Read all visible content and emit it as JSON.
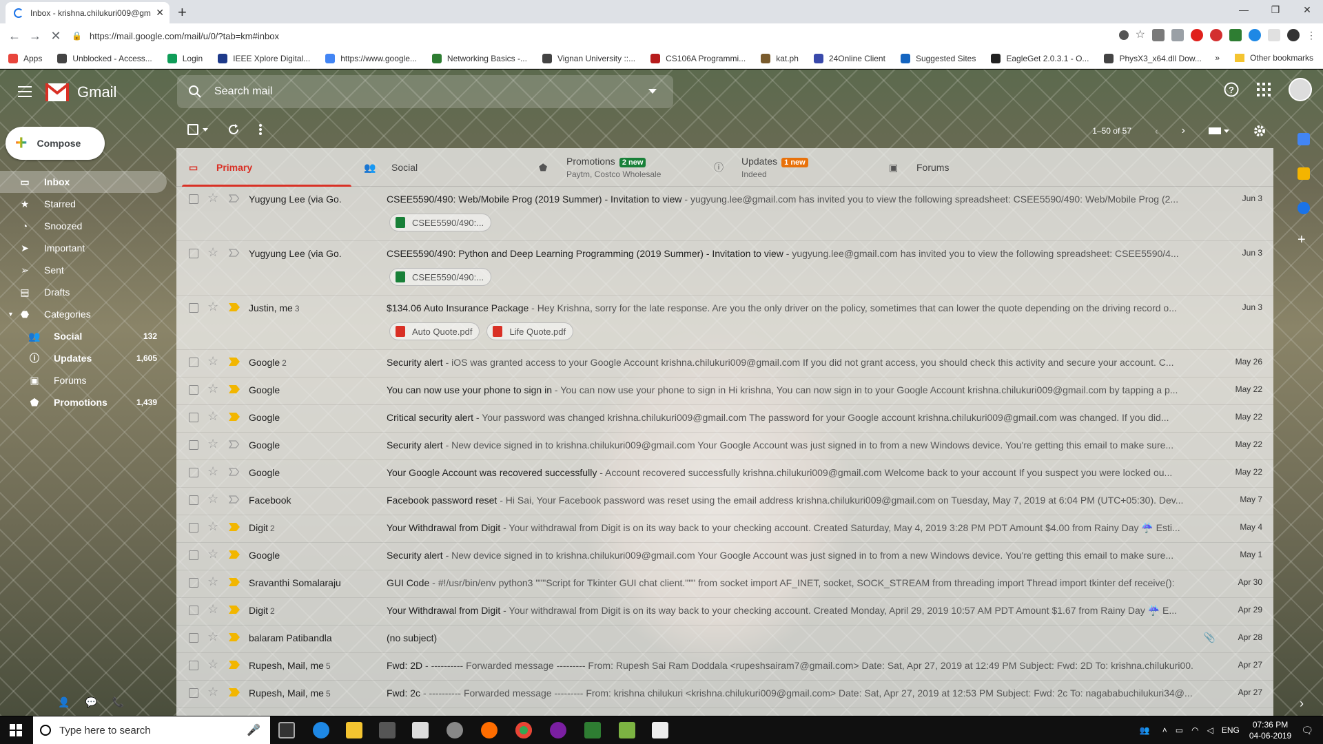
{
  "browser": {
    "tab_title": "Inbox - krishna.chilukuri009@gm",
    "url": "https://mail.google.com/mail/u/0/?tab=km#inbox",
    "bookmarks": [
      {
        "label": "Apps",
        "color": "#e8453c"
      },
      {
        "label": "Unblocked - Access...",
        "color": "#444"
      },
      {
        "label": "Login",
        "color": "#0f9d58"
      },
      {
        "label": "IEEE Xplore Digital...",
        "color": "#1e3a8a"
      },
      {
        "label": "https://www.google...",
        "color": "#4285f4"
      },
      {
        "label": "Networking Basics -...",
        "color": "#2e7d32"
      },
      {
        "label": "Vignan University ::...",
        "color": "#444"
      },
      {
        "label": "CS106A Programmi...",
        "color": "#b71c1c"
      },
      {
        "label": "kat.ph",
        "color": "#7a5c2e"
      },
      {
        "label": "24Online Client",
        "color": "#3949ab"
      },
      {
        "label": "Suggested Sites",
        "color": "#1565c0"
      },
      {
        "label": "EagleGet 2.0.3.1 - O...",
        "color": "#222"
      },
      {
        "label": "PhysX3_x64.dll Dow...",
        "color": "#444"
      }
    ],
    "bookmarks_more": "»",
    "other_bookmarks": "Other bookmarks"
  },
  "gmail": {
    "logo_text": "Gmail",
    "search_placeholder": "Search mail",
    "compose_label": "Compose",
    "pagination": "1–50 of 57",
    "nav": [
      {
        "label": "Inbox",
        "icon": "inbox-icon",
        "active": true
      },
      {
        "label": "Starred",
        "icon": "star-icon"
      },
      {
        "label": "Snoozed",
        "icon": "clock-icon"
      },
      {
        "label": "Important",
        "icon": "important-icon"
      },
      {
        "label": "Sent",
        "icon": "send-icon"
      },
      {
        "label": "Drafts",
        "icon": "draft-icon"
      },
      {
        "label": "Categories",
        "icon": "label-icon"
      }
    ],
    "categories": [
      {
        "label": "Social",
        "count": "132",
        "icon": "people-icon"
      },
      {
        "label": "Updates",
        "count": "1,605",
        "icon": "info-icon"
      },
      {
        "label": "Forums",
        "count": "",
        "icon": "forum-icon"
      },
      {
        "label": "Promotions",
        "count": "1,439",
        "icon": "tag-icon"
      }
    ],
    "tabs": [
      {
        "label": "Primary",
        "icon": "inbox-icon",
        "active": true
      },
      {
        "label": "Social",
        "icon": "people-icon"
      },
      {
        "label": "Promotions",
        "badge": "2 new",
        "badge_color": "#188038",
        "sub": "Paytm, Costco Wholesale",
        "icon": "tag-icon"
      },
      {
        "label": "Updates",
        "badge": "1 new",
        "badge_color": "#e8710a",
        "sub": "Indeed",
        "icon": "info-icon"
      },
      {
        "label": "Forums",
        "icon": "forum-icon"
      }
    ],
    "emails": [
      {
        "sender": "Yugyung Lee (via Go.",
        "count": "",
        "important": false,
        "subject": "CSEE5590/490: Web/Mobile Prog (2019 Summer) - Invitation to view",
        "snippet": " - yugyung.lee@gmail.com has invited you to view the following spreadsheet: CSEE5590/490: Web/Mobile Prog (2...",
        "date": "Jun 3",
        "attachments": [
          {
            "name": "CSEE5590/490:...",
            "type": "sheet"
          }
        ]
      },
      {
        "sender": "Yugyung Lee (via Go.",
        "count": "",
        "important": false,
        "subject": "CSEE5590/490: Python and Deep Learning Programming (2019 Summer) - Invitation to view",
        "snippet": " - yugyung.lee@gmail.com has invited you to view the following spreadsheet: CSEE5590/4...",
        "date": "Jun 3",
        "attachments": [
          {
            "name": "CSEE5590/490:...",
            "type": "sheet"
          }
        ]
      },
      {
        "sender": "Justin, me",
        "count": "3",
        "important": true,
        "subject": "$134.06 Auto Insurance Package",
        "snippet": " - Hey Krishna, sorry for the late response. Are you the only driver on the policy, sometimes that can lower the quote depending on the driving record o...",
        "date": "Jun 3",
        "attachments": [
          {
            "name": "Auto Quote.pdf",
            "type": "pdf"
          },
          {
            "name": "Life Quote.pdf",
            "type": "pdf"
          }
        ]
      },
      {
        "sender": "Google",
        "count": "2",
        "important": true,
        "subject": "Security alert",
        "snippet": " - iOS was granted access to your Google Account krishna.chilukuri009@gmail.com If you did not grant access, you should check this activity and secure your account. C...",
        "date": "May 26"
      },
      {
        "sender": "Google",
        "count": "",
        "important": true,
        "subject": "You can now use your phone to sign in",
        "snippet": " - You can now use your phone to sign in Hi krishna, You can now sign in to your Google Account krishna.chilukuri009@gmail.com by tapping a p...",
        "date": "May 22"
      },
      {
        "sender": "Google",
        "count": "",
        "important": true,
        "subject": "Critical security alert",
        "snippet": " - Your password was changed krishna.chilukuri009@gmail.com The password for your Google account krishna.chilukuri009@gmail.com was changed. If you did...",
        "date": "May 22"
      },
      {
        "sender": "Google",
        "count": "",
        "important": false,
        "subject": "Security alert",
        "snippet": " - New device signed in to krishna.chilukuri009@gmail.com Your Google Account was just signed in to from a new Windows device. You're getting this email to make sure...",
        "date": "May 22"
      },
      {
        "sender": "Google",
        "count": "",
        "important": false,
        "subject": "Your Google Account was recovered successfully",
        "snippet": " - Account recovered successfully krishna.chilukuri009@gmail.com Welcome back to your account If you suspect you were locked ou...",
        "date": "May 22"
      },
      {
        "sender": "Facebook",
        "count": "",
        "important": false,
        "subject": "Facebook password reset",
        "snippet": " - Hi Sai, Your Facebook password was reset using the email address krishna.chilukuri009@gmail.com on Tuesday, May 7, 2019 at 6:04 PM (UTC+05:30). Dev...",
        "date": "May 7"
      },
      {
        "sender": "Digit",
        "count": "2",
        "important": true,
        "subject": "Your Withdrawal from Digit",
        "snippet": " - Your withdrawal from Digit is on its way back to your checking account. Created Saturday, May 4, 2019 3:28 PM PDT Amount $4.00 from Rainy Day ☔ Esti...",
        "date": "May 4"
      },
      {
        "sender": "Google",
        "count": "",
        "important": true,
        "subject": "Security alert",
        "snippet": " - New device signed in to krishna.chilukuri009@gmail.com Your Google Account was just signed in to from a new Windows device. You're getting this email to make sure...",
        "date": "May 1"
      },
      {
        "sender": "Sravanthi Somalaraju",
        "count": "",
        "important": true,
        "subject": "GUI Code",
        "snippet": " - #!/usr/bin/env python3 \"\"\"Script for Tkinter GUI chat client.\"\"\" from socket import AF_INET, socket, SOCK_STREAM from threading import Thread import tkinter def receive():",
        "date": "Apr 30"
      },
      {
        "sender": "Digit",
        "count": "2",
        "important": true,
        "subject": "Your Withdrawal from Digit",
        "snippet": " - Your withdrawal from Digit is on its way back to your checking account. Created Monday, April 29, 2019 10:57 AM PDT Amount $1.67 from Rainy Day ☔ E...",
        "date": "Apr 29"
      },
      {
        "sender": "balaram Patibandla",
        "count": "",
        "important": true,
        "subject": "(no subject)",
        "snippet": "",
        "date": "Apr 28",
        "clip": true
      },
      {
        "sender": "Rupesh, Mail, me",
        "count": "5",
        "important": true,
        "subject": "Fwd: 2D",
        "snippet": " - ---------- Forwarded message --------- From: Rupesh Sai Ram Doddala <rupeshsairam7@gmail.com> Date: Sat, Apr 27, 2019 at 12:49 PM Subject: Fwd: 2D To: krishna.chilukuri00...",
        "date": "Apr 27"
      },
      {
        "sender": "Rupesh, Mail, me",
        "count": "5",
        "important": true,
        "subject": "Fwd: 2c",
        "snippet": " - ---------- Forwarded message --------- From: krishna chilukuri <krishna.chilukuri009@gmail.com> Date: Sat, Apr 27, 2019 at 12:53 PM Subject: Fwd: 2c To: nagababuchilukuri34@...",
        "date": "Apr 27"
      }
    ]
  },
  "taskbar": {
    "search_placeholder": "Type here to search",
    "lang": "ENG",
    "time": "07:36 PM",
    "date": "04-06-2019"
  },
  "colors": {
    "primary_red": "#d93025",
    "important_yellow": "#f2b600"
  }
}
